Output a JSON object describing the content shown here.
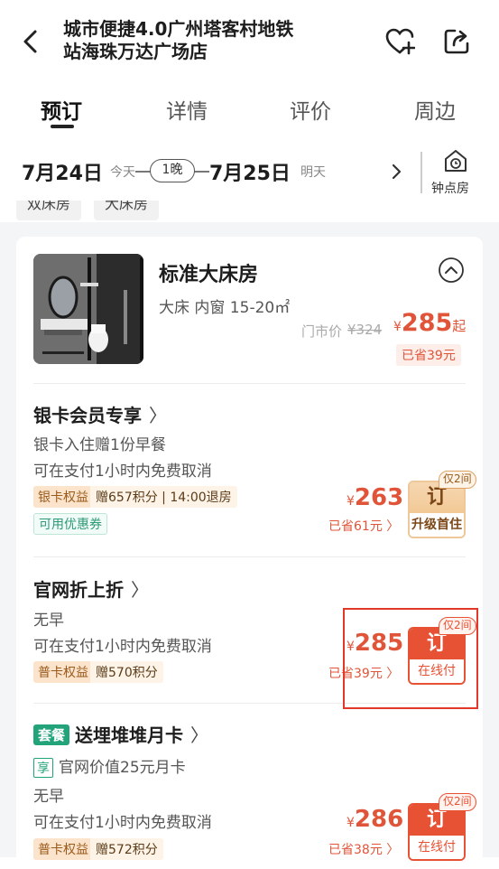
{
  "header": {
    "title_line1": "城市便捷4.0广州塔客村地铁",
    "title_line2": "站海珠万达广场店"
  },
  "tabs": [
    {
      "label": "预订"
    },
    {
      "label": "详情"
    },
    {
      "label": "评价"
    },
    {
      "label": "周边"
    }
  ],
  "dates": {
    "checkin": "7月24日",
    "checkin_sub": "今天",
    "nights": "1晚",
    "checkout": "7月25日",
    "checkout_sub": "明天",
    "hour_room": "钟点房"
  },
  "chips": [
    "双床房",
    "大床房"
  ],
  "room": {
    "title": "标准大床房",
    "subtitle": "大床 内窗 15-20㎡",
    "list_price_label": "门市价",
    "list_price": "¥324",
    "price_yen": "¥",
    "price": "285",
    "price_suffix": "起",
    "saved": "已省39元"
  },
  "offers": [
    {
      "title": "银卡会员专享",
      "lines": [
        "银卡入住赠1份早餐",
        "可在支付1小时内免费取消"
      ],
      "tag_main": "银卡权益",
      "tag_ext": "赠657积分 | 14:00退房",
      "coupon": "可用优惠券",
      "price_yen": "¥",
      "price": "263",
      "saved": "已省61元 〉",
      "limit": "仅2间",
      "btn_top": "订",
      "btn_bottom": "升级首住"
    },
    {
      "title": "官网折上折",
      "lines": [
        "无早",
        "可在支付1小时内免费取消"
      ],
      "tag_main": "普卡权益",
      "tag_ext": "赠570积分",
      "price_yen": "¥",
      "price": "285",
      "saved": "已省39元 〉",
      "limit": "仅2间",
      "btn_top": "订",
      "btn_bottom": "在线付"
    },
    {
      "pkg_tag": "套餐",
      "title": "送埋堆堆月卡",
      "xiang": "享",
      "xiang_text": "官网价值25元月卡",
      "lines": [
        "无早",
        "可在支付1小时内免费取消"
      ],
      "tag_main": "普卡权益",
      "tag_ext": "赠572积分",
      "price_yen": "¥",
      "price": "286",
      "saved": "已省38元 〉",
      "limit": "仅2间",
      "btn_top": "订",
      "btn_bottom": "在线付"
    }
  ],
  "colors": {
    "accent": "#e85234",
    "price": "#e0553a",
    "gold": "#fbe4cb",
    "green": "#23a37a"
  }
}
